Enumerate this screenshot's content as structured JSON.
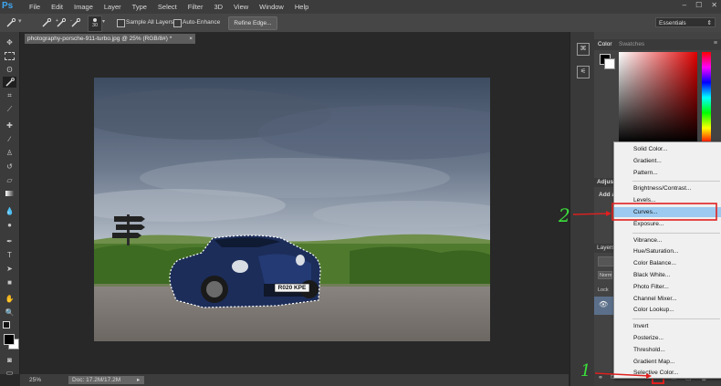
{
  "app": {
    "logo": "Ps",
    "menu": [
      "File",
      "Edit",
      "Image",
      "Layer",
      "Type",
      "Select",
      "Filter",
      "3D",
      "View",
      "Window",
      "Help"
    ]
  },
  "options_bar": {
    "brush_size": "30",
    "sample_all_layers": "Sample All Layers",
    "auto_enhance": "Auto-Enhance",
    "refine_edge": "Refine Edge...",
    "workspace": "Essentials"
  },
  "document": {
    "tab_title": "photography-porsche-911-turbo.jpg @ 25% (RGB/8#) *",
    "plate_text": "R020 KPE"
  },
  "status_bar": {
    "zoom": "25%",
    "doc_info": "Doc: 17.2M/17.2M"
  },
  "panels": {
    "color_tab": "Color",
    "swatches_tab": "Swatches",
    "adjustments_label": "Adjust",
    "add_label": "Add a",
    "layers_label": "Layers",
    "normal_label": "Norm",
    "lock_label": "Lock"
  },
  "adjustment_menu": {
    "groups": [
      [
        "Solid Color...",
        "Gradient...",
        "Pattern..."
      ],
      [
        "Brightness/Contrast...",
        "Levels...",
        "Curves...",
        "Exposure..."
      ],
      [
        "Vibrance...",
        "Hue/Saturation...",
        "Color Balance...",
        "Black  White...",
        "Photo Filter...",
        "Channel Mixer...",
        "Color Lookup..."
      ],
      [
        "Invert",
        "Posterize...",
        "Threshold...",
        "Gradient Map...",
        "Selective Color..."
      ]
    ],
    "highlighted": "Curves..."
  },
  "annotations": {
    "step1": "1",
    "step2": "2",
    "accent": "#e02020",
    "number_color": "#3be03b"
  }
}
